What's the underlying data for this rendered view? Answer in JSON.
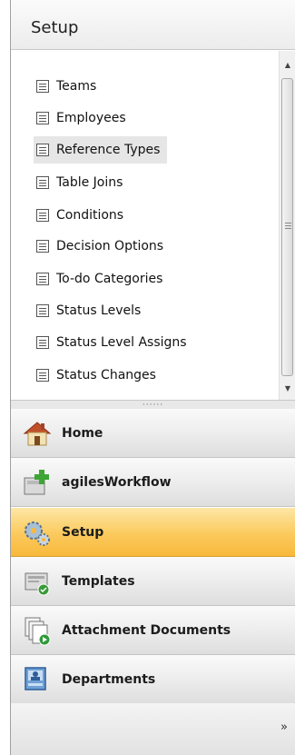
{
  "header": {
    "title": "Setup"
  },
  "tree": {
    "items": [
      {
        "label": "Teams"
      },
      {
        "label": "Employees"
      },
      {
        "label": "Reference Types",
        "selected": true
      },
      {
        "label": "Table Joins"
      },
      {
        "label": "Conditions"
      },
      {
        "label": "Decision Options"
      },
      {
        "label": "To-do Categories"
      },
      {
        "label": "Status Levels"
      },
      {
        "label": "Status Level Assigns"
      },
      {
        "label": "Status Changes"
      }
    ]
  },
  "navigation": {
    "buttons": [
      {
        "label": "Home",
        "icon": "home-icon"
      },
      {
        "label": "agilesWorkflow",
        "icon": "workflow-add-icon"
      },
      {
        "label": "Setup",
        "icon": "gears-icon",
        "active": true
      },
      {
        "label": "Templates",
        "icon": "templates-icon"
      },
      {
        "label": "Attachment Documents",
        "icon": "attachment-documents-icon"
      },
      {
        "label": "Departments",
        "icon": "departments-icon"
      }
    ]
  },
  "colors": {
    "active_nav": "#fbc95c",
    "selected_item": "#e6e6e6"
  }
}
